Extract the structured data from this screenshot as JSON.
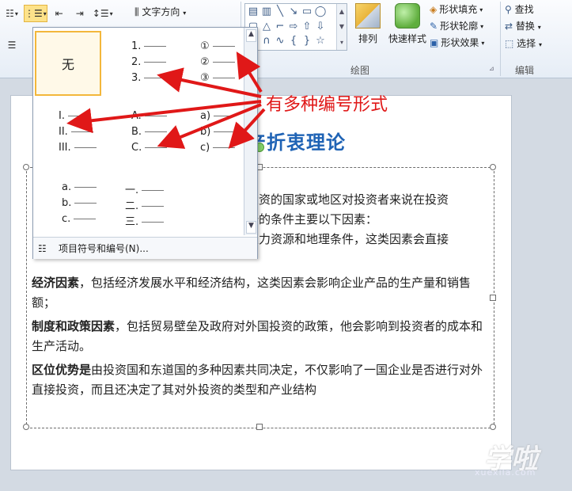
{
  "ribbon": {
    "text_direction": "文字方向",
    "arrange": "排列",
    "quick_styles": "快速样式",
    "shape_fill": "形状填充",
    "shape_outline": "形状轮廓",
    "shape_effects": "形状效果",
    "find": "查找",
    "replace": "替换",
    "select": "选择",
    "group_drawing": "绘图",
    "group_editing": "编辑"
  },
  "gallery": {
    "none_label": "无",
    "formats": {
      "arabic": [
        "1.",
        "2.",
        "3."
      ],
      "circled": [
        "①",
        "②",
        "③"
      ],
      "roman_upper": [
        "I.",
        "II.",
        "III."
      ],
      "alpha_upper": [
        "A.",
        "B.",
        "C."
      ],
      "alpha_lower_paren": [
        "a)",
        "b)",
        "c)"
      ],
      "alpha_lower_dot": [
        "a.",
        "b.",
        "c."
      ],
      "chinese": [
        "一.",
        "二.",
        "三."
      ]
    },
    "footer_label": "项目符号和编号(N)..."
  },
  "annotation": "有多种编号形式",
  "document": {
    "title_visible": "产折衷理论",
    "line1_right": "投资的国家或地区对投资者来说在投资",
    "line2_right": "势的条件主要以下因素：",
    "line3_right": "人力资源和地理条件，这类因素会直接",
    "para_econ_bold": "经济因素",
    "para_econ_text": "，包括经济发展水平和经济结构，这类因素会影响企业产品的生产量和销售额；",
    "para_policy_bold": "制度和政策因素",
    "para_policy_text": "，包括贸易壁垒及政府对外国投资的政策，他会影响到投资者的成本和生产活动。",
    "para_location_bold": "区位优势是",
    "para_location_text": "由投资国和东道国的多种因素共同决定，不仅影响了一国企业是否进行对外直接投资，而且还决定了其对外投资的类型和产业结构"
  },
  "watermark": {
    "logo": "学啦",
    "sub": "xuexila.com"
  },
  "colors": {
    "annotation": "#e01818",
    "title": "#1f63b5",
    "selection": "#f3b73b"
  }
}
